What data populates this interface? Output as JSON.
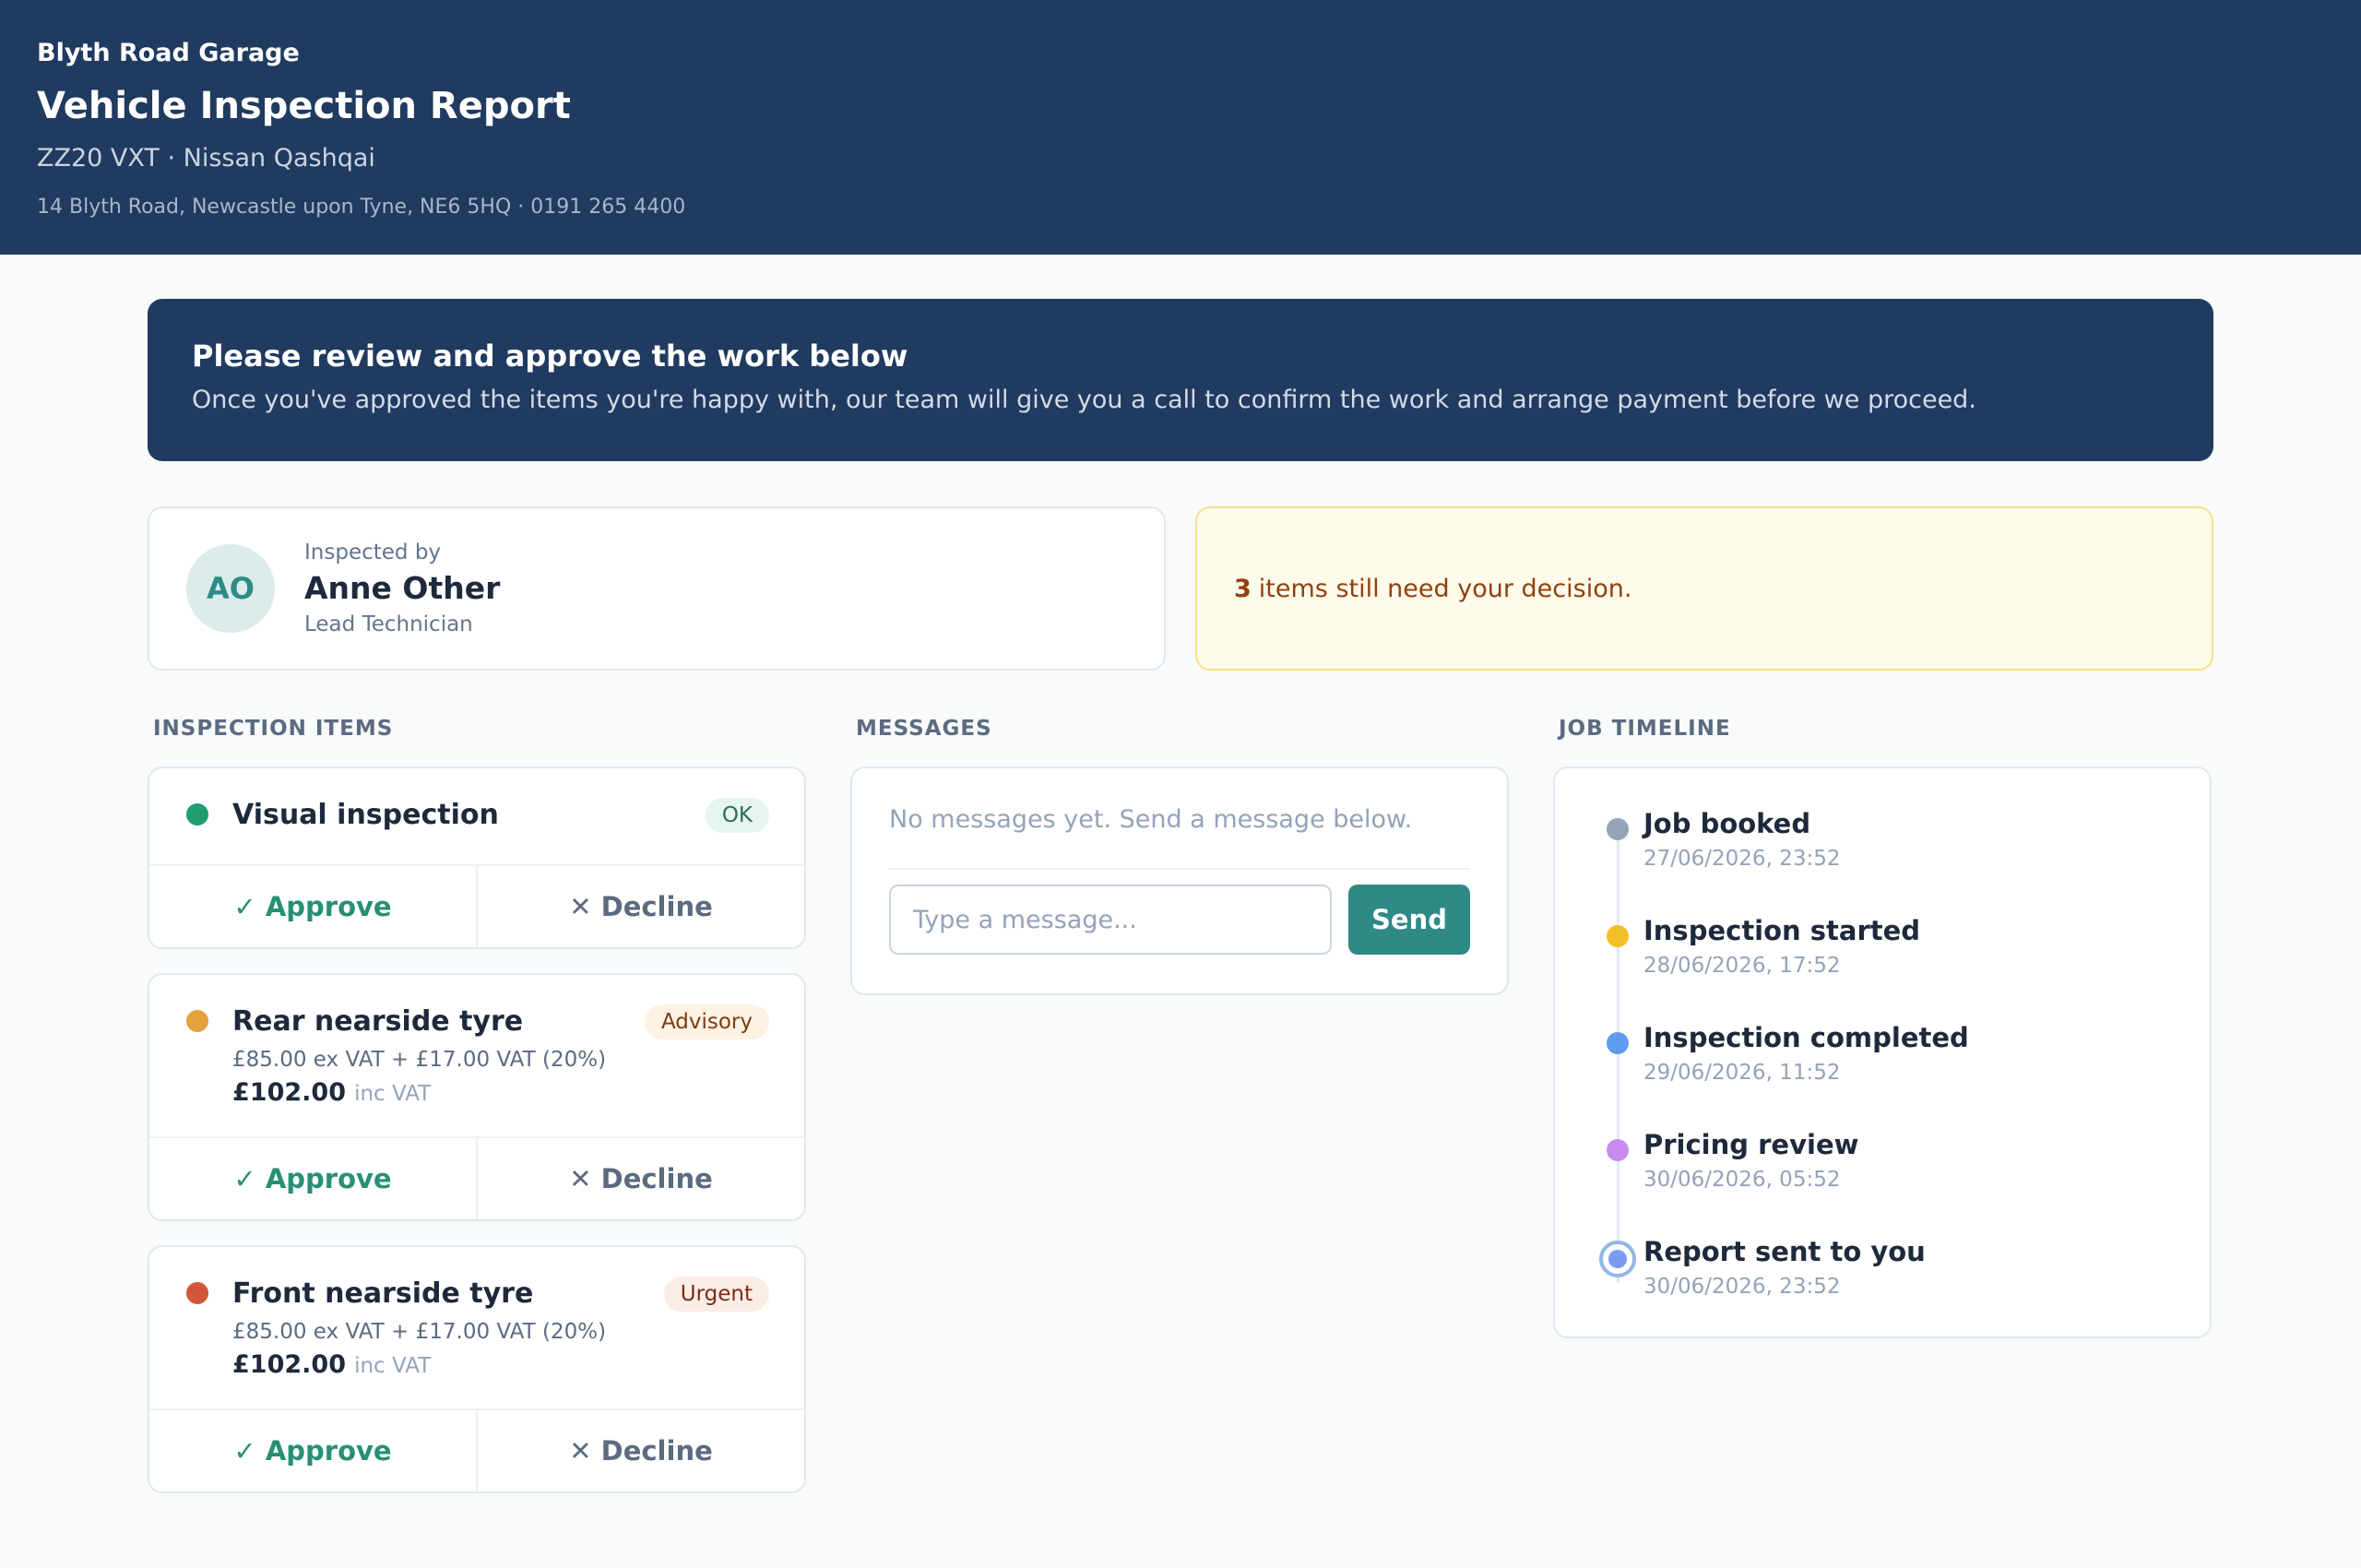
{
  "header": {
    "garage_name": "Blyth Road Garage",
    "title": "Vehicle Inspection Report",
    "vehicle": "ZZ20 VXT · Nissan Qashqai",
    "address": "14 Blyth Road, Newcastle upon Tyne, NE6 5HQ · 0191 265 4400"
  },
  "banner": {
    "title": "Please review and approve the work below",
    "text": "Once you've approved the items you're happy with, our team will give you a call to confirm the work and arrange payment before we proceed."
  },
  "inspector": {
    "label": "Inspected by",
    "initials": "AO",
    "name": "Anne Other",
    "role": "Lead Technician"
  },
  "decision_notice": {
    "count": "3",
    "text": "items still need your decision."
  },
  "inspection": {
    "heading": "INSPECTION ITEMS",
    "items": [
      {
        "name": "Visual inspection",
        "status": "OK",
        "dot_color": "#1f9d6e",
        "badge_bg": "#e6f5ef",
        "badge_color": "#2f6b58",
        "approve_label": "✓ Approve",
        "decline_label": "✕ Decline"
      },
      {
        "name": "Rear nearside tyre",
        "status": "Advisory",
        "dot_color": "#e6a03c",
        "badge_bg": "#fdf2e3",
        "badge_color": "#7c3b12",
        "price_detail": "£85.00 ex VAT + £17.00 VAT (20%)",
        "price_total": "£102.00",
        "price_suffix": "inc VAT",
        "approve_label": "✓ Approve",
        "decline_label": "✕ Decline"
      },
      {
        "name": "Front nearside tyre",
        "status": "Urgent",
        "dot_color": "#d2563a",
        "badge_bg": "#fcece6",
        "badge_color": "#7c2d12",
        "price_detail": "£85.00 ex VAT + £17.00 VAT (20%)",
        "price_total": "£102.00",
        "price_suffix": "inc VAT",
        "approve_label": "✓ Approve",
        "decline_label": "✕ Decline"
      }
    ]
  },
  "messages": {
    "heading": "MESSAGES",
    "empty_text": "No messages yet. Send a message below.",
    "input_placeholder": "Type a message...",
    "send_label": "Send"
  },
  "timeline": {
    "heading": "JOB TIMELINE",
    "events": [
      {
        "label": "Job booked",
        "time": "27/06/2026, 23:52",
        "color": "#94a3b8"
      },
      {
        "label": "Inspection started",
        "time": "28/06/2026, 17:52",
        "color": "#f4bf26"
      },
      {
        "label": "Inspection completed",
        "time": "29/06/2026, 11:52",
        "color": "#5f9cf0"
      },
      {
        "label": "Pricing review",
        "time": "30/06/2026, 05:52",
        "color": "#c88af0"
      },
      {
        "label": "Report sent to you",
        "time": "30/06/2026, 23:52",
        "color": "#7b9af2"
      }
    ]
  }
}
